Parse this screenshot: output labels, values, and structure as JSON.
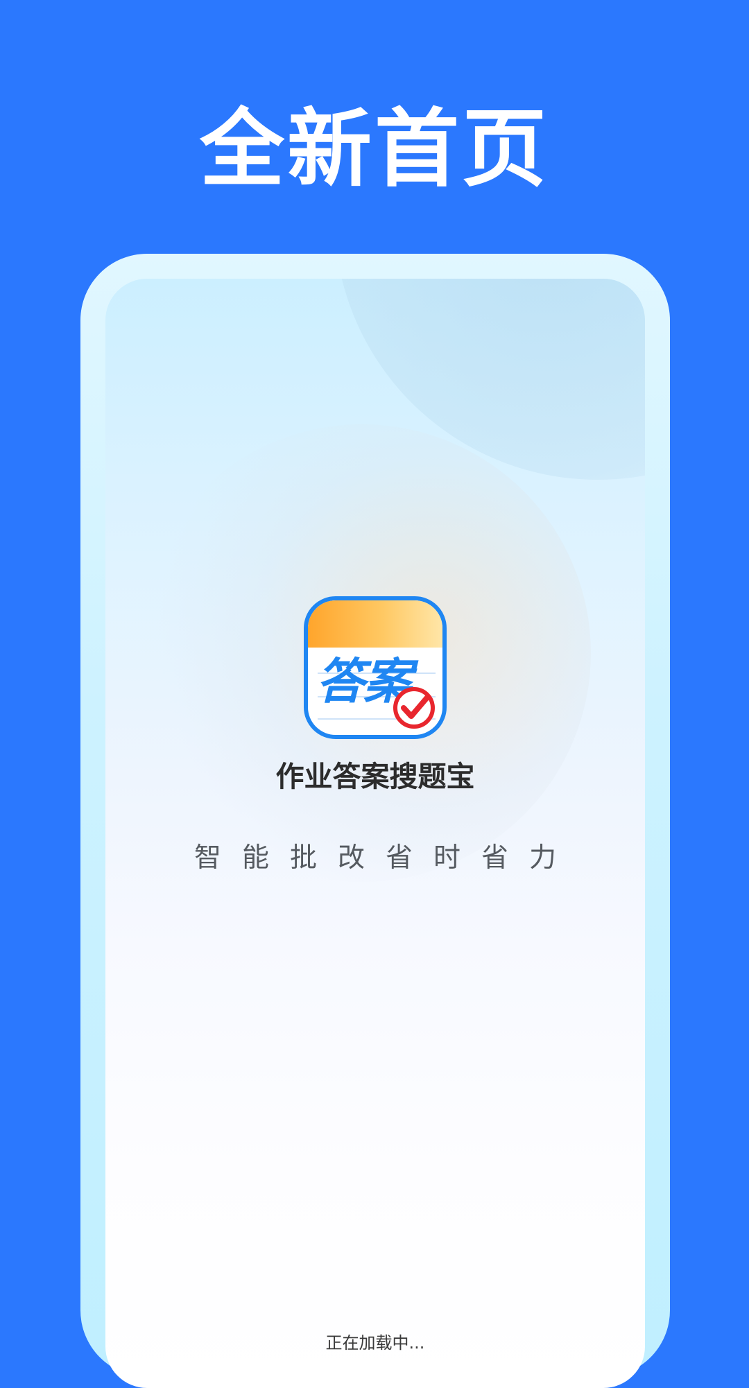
{
  "banner": {
    "headline": "全新首页"
  },
  "splash": {
    "app_icon": {
      "name": "answer-check-app-icon",
      "icon_text": "答案",
      "accent_color": "#1f86f2",
      "band_color": "#ffa52c",
      "badge_color": "#e8262e"
    },
    "app_name": "作业答案搜题宝",
    "slogan": "智能批改省时省力",
    "loading_text": "正在加载中..."
  },
  "colors": {
    "background": "#2b78fe",
    "frame": "#cdf2ff"
  }
}
